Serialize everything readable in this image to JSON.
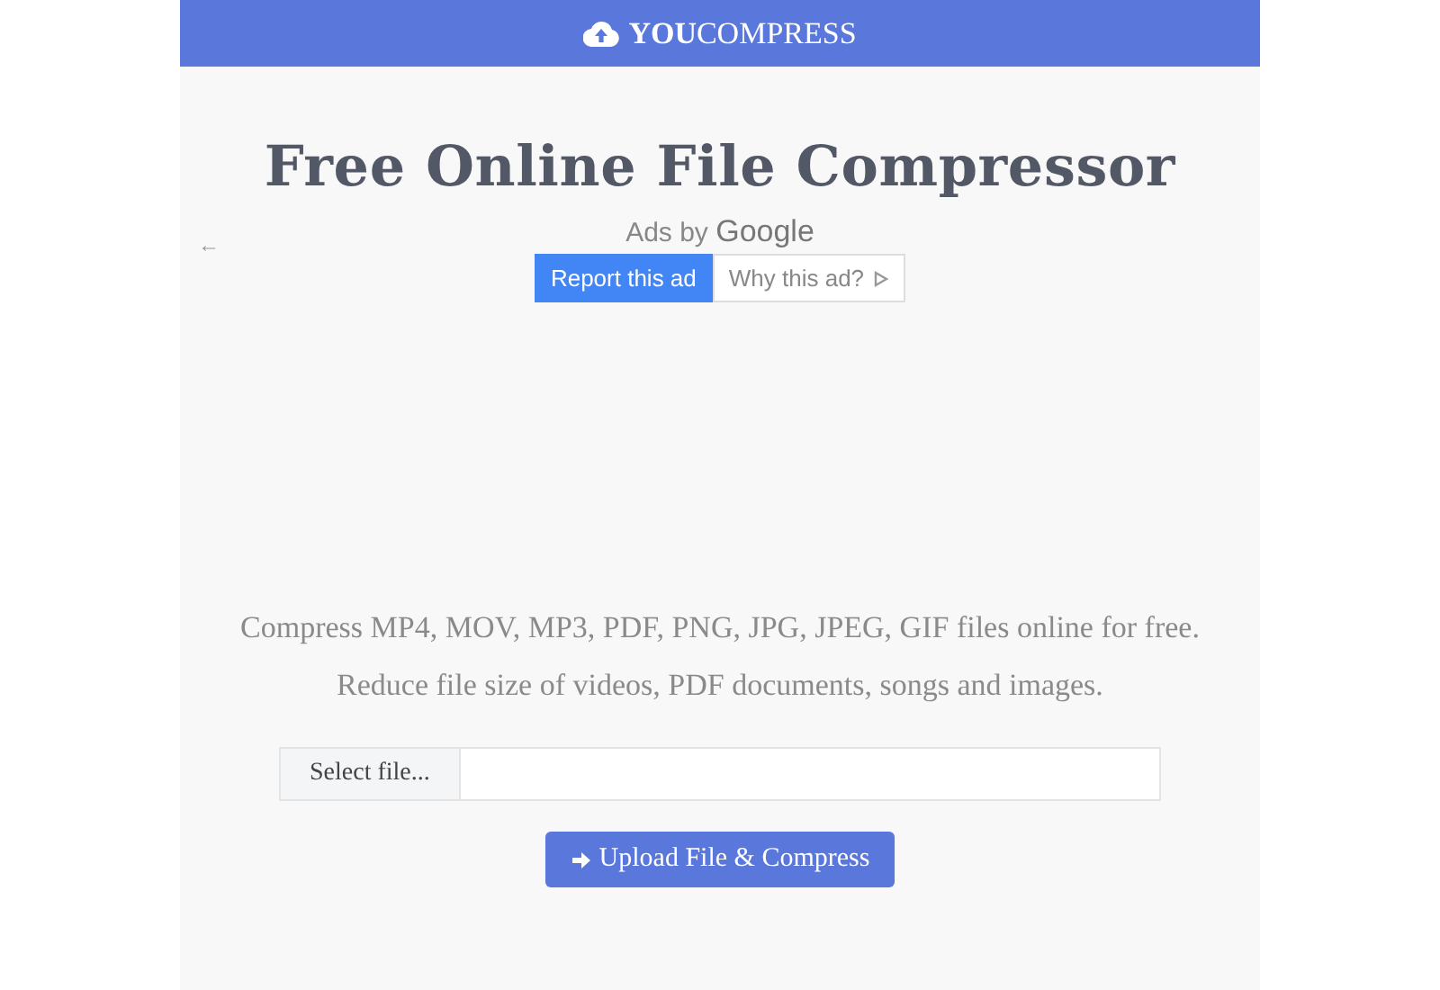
{
  "header": {
    "logo": "**YOU**COMPRESS"
  },
  "title": "Free Online File Compressor",
  "ad": {
    "back": "←",
    "ads_by": "Ads by",
    "brand": "Google",
    "report": "Report this ad",
    "why": "Why this ad?"
  },
  "taglines": [
    "Compress MP4, MOV, MP3, PDF, PNG, JPG, JPEG, GIF files online for free.",
    "Reduce file size of videos, PDF documents, songs and images."
  ],
  "file_field": {
    "button": "Select file..."
  },
  "upload_button": "Upload File & Compress"
}
